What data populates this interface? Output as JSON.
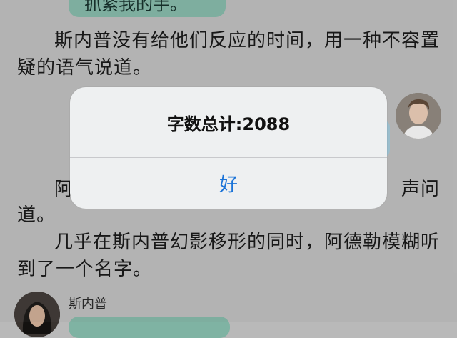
{
  "story": {
    "top_bubble_text": "抓紧我的手。",
    "paragraph_1": "斯内普没有给他们反应的时间，用一种不容置疑的语气说道。",
    "paragraph_2_start": "阿",
    "paragraph_2_end_fragment": "声问",
    "paragraph_2_line2": "道。",
    "paragraph_3": "几乎在斯内普幻影移形的同时，阿德勒模糊听到了一个名字。",
    "speaker_name": "斯内普"
  },
  "alert": {
    "title": "字数总计:2088",
    "ok_label": "好"
  },
  "colors": {
    "bubble": "#7fb3a3",
    "accent": "#1a73d8",
    "background": "#b9b9b9"
  }
}
